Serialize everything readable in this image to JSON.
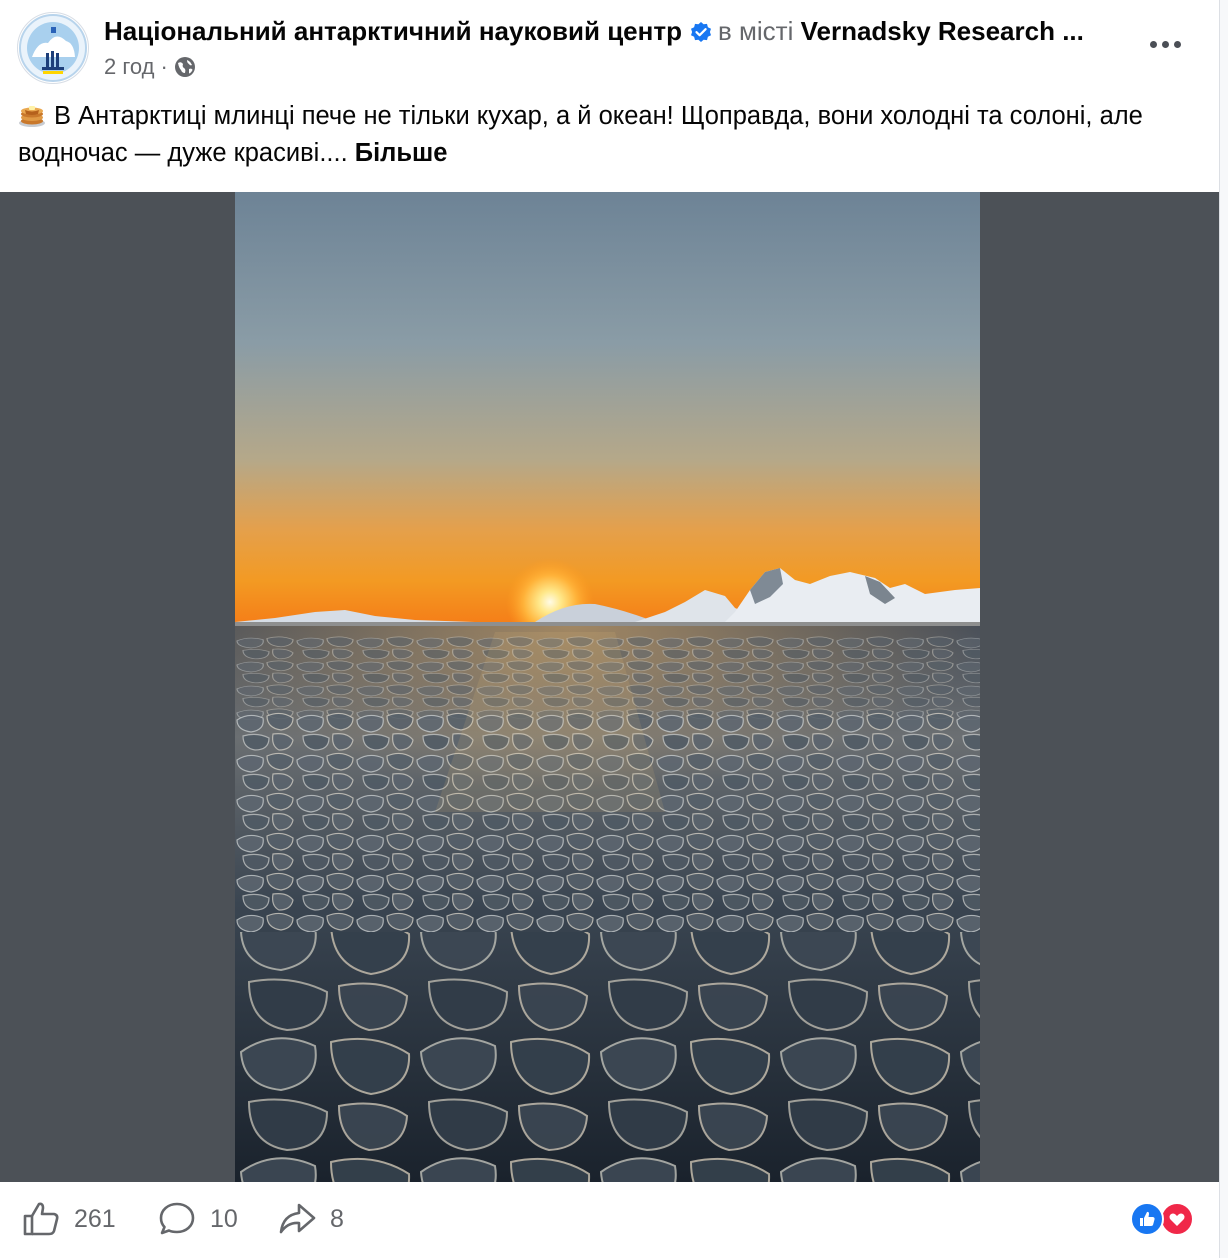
{
  "post": {
    "page_name": "Національний антарктичний науковий центр",
    "location_prefix": "в місті",
    "location_name": "Vernadsky Research ...",
    "time": "2 год",
    "separator": "·",
    "text_line": "В Антарктиці млинці пече не тільки кухар, а й океан! Щоправда, вони холодні та солоні, але водночас — дуже красиві....",
    "see_more": "Більше"
  },
  "icons": {
    "verified": "verified-badge-icon",
    "audience": "globe-icon",
    "emoji": "pancake-emoji-icon",
    "more": "more-options-icon"
  },
  "actions": {
    "likes": "261",
    "comments": "10",
    "shares": "8"
  },
  "colors": {
    "accent": "#1877f2",
    "love": "#f02849",
    "secondary_text": "#65676b",
    "photo_backdrop": "#4c5157"
  }
}
